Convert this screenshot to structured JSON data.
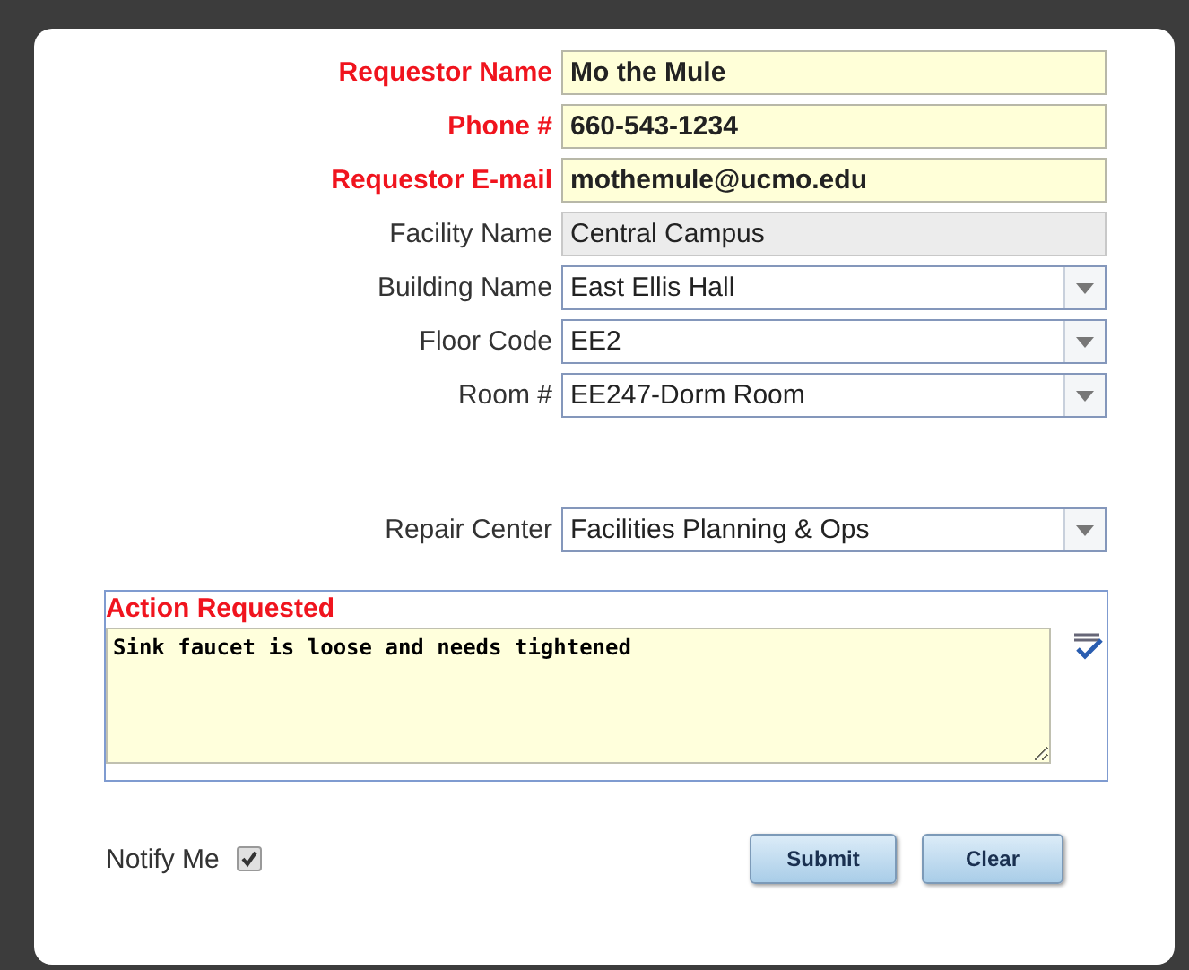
{
  "fields": [
    {
      "label": "Requestor Name",
      "kind": "text",
      "required": true,
      "value": "Mo the Mule"
    },
    {
      "label": "Phone #",
      "kind": "text",
      "required": true,
      "value": "660-543-1234"
    },
    {
      "label": "Requestor E-mail",
      "kind": "text",
      "required": true,
      "value": "mothemule@ucmo.edu"
    },
    {
      "label": "Facility Name",
      "kind": "readonly",
      "required": false,
      "value": "Central Campus"
    },
    {
      "label": "Building Name",
      "kind": "select",
      "required": false,
      "value": "East Ellis Hall"
    },
    {
      "label": "Floor Code",
      "kind": "select",
      "required": false,
      "value": "EE2"
    },
    {
      "label": "Room #",
      "kind": "select",
      "required": false,
      "value": "EE247-Dorm Room"
    }
  ],
  "repair_center": {
    "label": "Repair Center",
    "kind": "select",
    "required": false,
    "value": "Facilities Planning & Ops"
  },
  "action": {
    "label": "Action Requested",
    "value": "Sink faucet is loose and needs tightened"
  },
  "notify": {
    "label": "Notify Me",
    "checked": true
  },
  "buttons": [
    "Submit",
    "Clear"
  ]
}
